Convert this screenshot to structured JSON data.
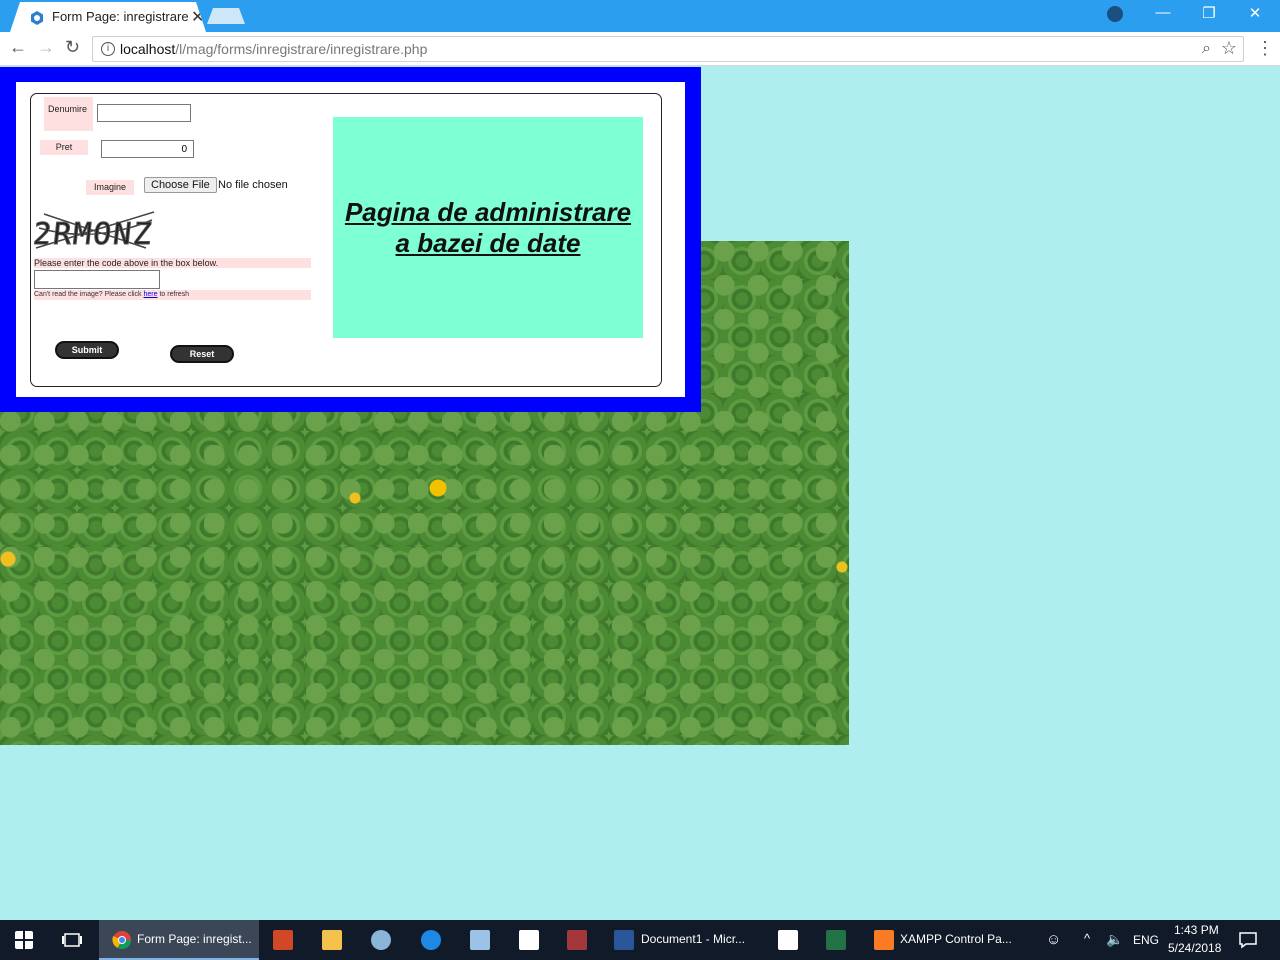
{
  "browser": {
    "tab_title": "Form Page: inregistrare",
    "tab_close": "✕",
    "url_host": "localhost",
    "url_path": "/l/mag/forms/inregistrare/inregistrare.php",
    "window_controls": {
      "minimize": "—",
      "restore": "❐",
      "close": "✕"
    },
    "nav": {
      "back": "←",
      "forward": "→",
      "reload": "↻"
    },
    "menu": "⋮"
  },
  "form": {
    "denumire_label": "Denumire",
    "denumire_value": "",
    "pret_label": "Pret",
    "pret_value": "0",
    "imagine_label": "Imagine",
    "file_button": "Choose File",
    "file_status": "No file chosen",
    "captcha_text": "2RMONZ",
    "captcha_prompt": "Please enter the code above in the box below.",
    "captcha_value": "",
    "refresh_prefix": "Can't read the image? Please click ",
    "refresh_link": "here",
    "refresh_suffix": " to refresh",
    "submit_label": "Submit",
    "reset_label": "Reset"
  },
  "page": {
    "heading": "Pagina de administrare a bazei de date"
  },
  "colors": {
    "page_bg": "#afeeee",
    "frame": "#0000ff",
    "title_bg": "#7fffd4",
    "label_bg": "#ffe0e0"
  },
  "taskbar": {
    "chrome_label": "Form Page: inregist...",
    "word_label": "Document1 - Micr...",
    "xampp_label": "XAMPP Control Pa...",
    "language": "ENG",
    "time": "1:43 PM",
    "date": "5/24/2018"
  }
}
